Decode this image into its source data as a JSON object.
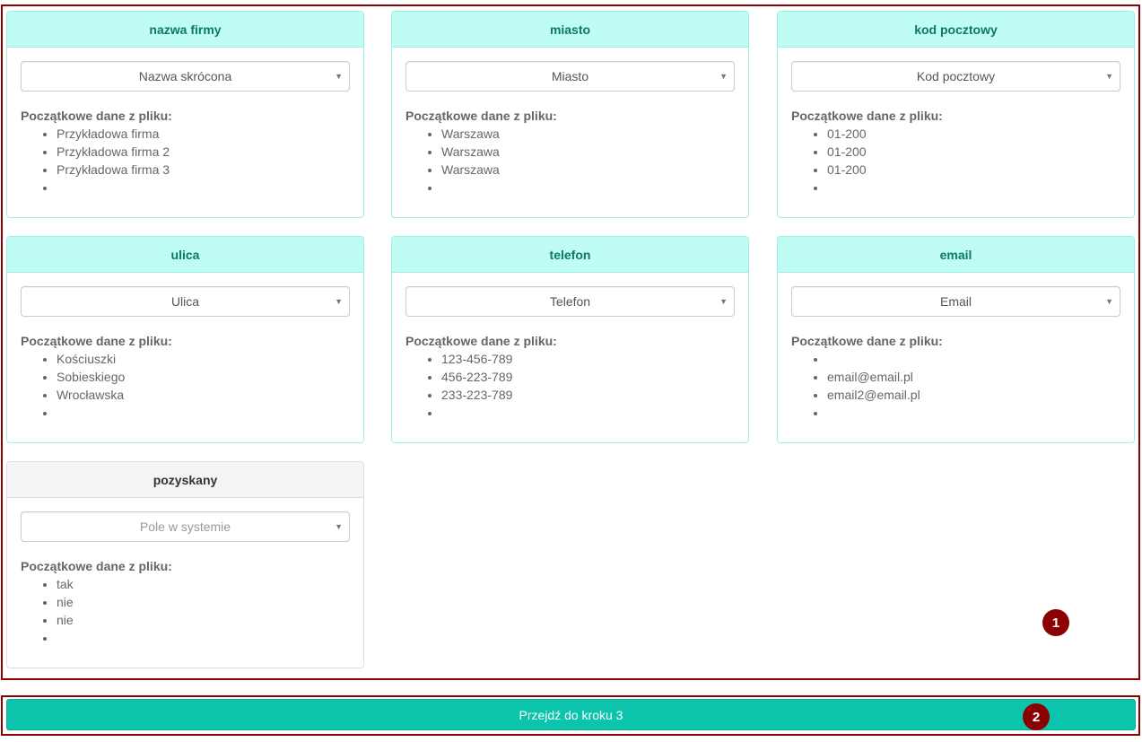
{
  "initial_data_label": "Początkowe dane z pliku:",
  "fields": [
    {
      "title": "nazwa firmy",
      "selected": "Nazwa skrócona",
      "is_placeholder": false,
      "values": [
        "Przykładowa firma",
        "Przykładowa firma 2",
        "Przykładowa firma 3",
        ""
      ]
    },
    {
      "title": "miasto",
      "selected": "Miasto",
      "is_placeholder": false,
      "values": [
        "Warszawa",
        "Warszawa",
        "Warszawa",
        ""
      ]
    },
    {
      "title": "kod pocztowy",
      "selected": "Kod pocztowy",
      "is_placeholder": false,
      "values": [
        "01-200",
        "01-200",
        "01-200",
        ""
      ]
    },
    {
      "title": "ulica",
      "selected": "Ulica",
      "is_placeholder": false,
      "values": [
        "Kościuszki",
        "Sobieskiego",
        "Wrocławska",
        ""
      ]
    },
    {
      "title": "telefon",
      "selected": "Telefon",
      "is_placeholder": false,
      "values": [
        "123-456-789",
        "456-223-789",
        "233-223-789",
        ""
      ]
    },
    {
      "title": "email",
      "selected": "Email",
      "is_placeholder": false,
      "values": [
        "",
        "email@email.pl",
        "email2@email.pl",
        ""
      ]
    },
    {
      "title": "pozyskany",
      "selected": "Pole w systemie",
      "is_placeholder": true,
      "values": [
        "tak",
        "nie",
        "nie",
        ""
      ]
    }
  ],
  "next_button_label": "Przejdź do kroku 3",
  "markers": [
    "1",
    "2"
  ],
  "colors": {
    "accent": "#0bc4ab",
    "panel_heading_matched": "#bffcf3",
    "panel_heading_unmatched": "#f5f5f5",
    "marker": "#8b0000"
  }
}
